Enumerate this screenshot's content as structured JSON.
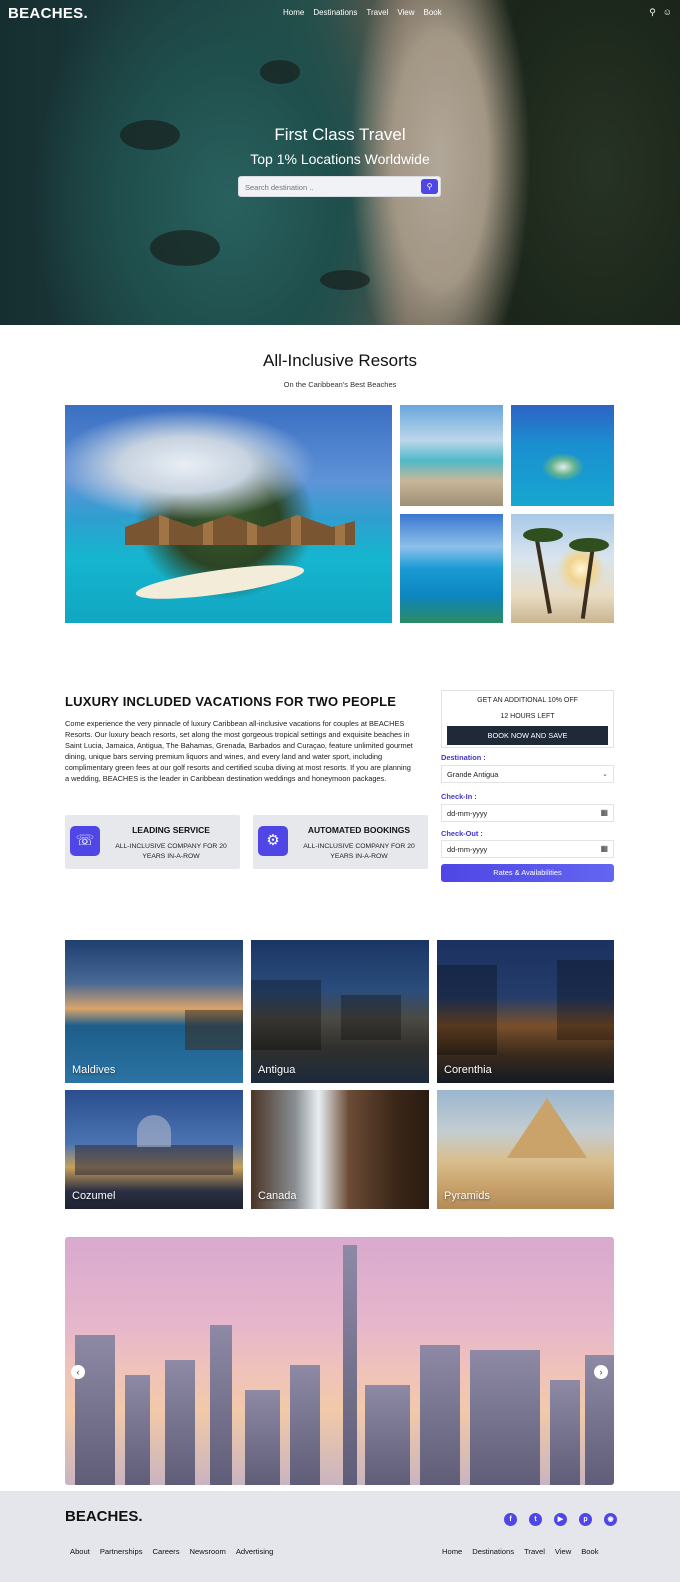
{
  "brand": {
    "logo": "BEACHES."
  },
  "nav": {
    "items": [
      "Home",
      "Destinations",
      "Travel",
      "View",
      "Book"
    ]
  },
  "hero": {
    "title": "First Class Travel",
    "subtitle": "Top 1% Locations Worldwide",
    "search_placeholder": "Search destination .."
  },
  "resorts": {
    "title": "All-Inclusive Resorts",
    "subtitle": "On the Caribbean's Best Beaches"
  },
  "luxury": {
    "title": "LUXURY INCLUDED VACATIONS FOR TWO PEOPLE",
    "body": "Come experience the very pinnacle of luxury Caribbean all-inclusive vacations for couples at BEACHES Resorts. Our luxury beach resorts, set along the most gorgeous tropical settings and exquisite beaches in Saint Lucia, Jamaica, Antigua, The Bahamas, Grenada, Barbados and Curaçao, feature unlimited gourmet dining, unique bars serving premium liquors and wines, and every land and water sport, including complimentary green fees at our golf resorts and certified scuba diving at most resorts. If you are planning a wedding, BEACHES is the leader in Caribbean destination weddings and honeymoon packages.",
    "features": [
      {
        "title": "LEADING SERVICE",
        "desc": "ALL-INCLUSIVE COMPANY FOR 20 YEARS IN-A-ROW",
        "icon": "headset-icon"
      },
      {
        "title": "AUTOMATED BOOKINGS",
        "desc": "ALL-INCLUSIVE COMPANY FOR 20 YEARS IN-A-ROW",
        "icon": "search-settings-icon"
      }
    ]
  },
  "booking": {
    "offer_line1": "GET AN ADDITIONAL 10% OFF",
    "offer_line2": "12 HOURS LEFT",
    "book_button": "BOOK NOW AND SAVE",
    "destination_label": "Destination :",
    "destination_value": "Grande Antigua",
    "checkin_label": "Check-In :",
    "checkin_placeholder": "dd-mm-yyyy",
    "checkout_label": "Check-Out :",
    "checkout_placeholder": "dd-mm-yyyy",
    "rates_button": "Rates & Availabilities"
  },
  "destinations": [
    "Maldives",
    "Antigua",
    "Corenthia",
    "Cozumel",
    "Canada",
    "Pyramids"
  ],
  "footer": {
    "logo": "BEACHES.",
    "left_links": [
      "About",
      "Partnerships",
      "Careers",
      "Newsroom",
      "Advertising"
    ],
    "right_links": [
      "Home",
      "Destinations",
      "Travel",
      "View",
      "Book"
    ],
    "social": [
      "facebook-icon",
      "twitter-icon",
      "youtube-icon",
      "pinterest-icon",
      "instagram-icon"
    ]
  },
  "colors": {
    "accent": "#4f46e5",
    "dark_button": "#1f2937",
    "footer_bg": "#e5e6eb"
  }
}
